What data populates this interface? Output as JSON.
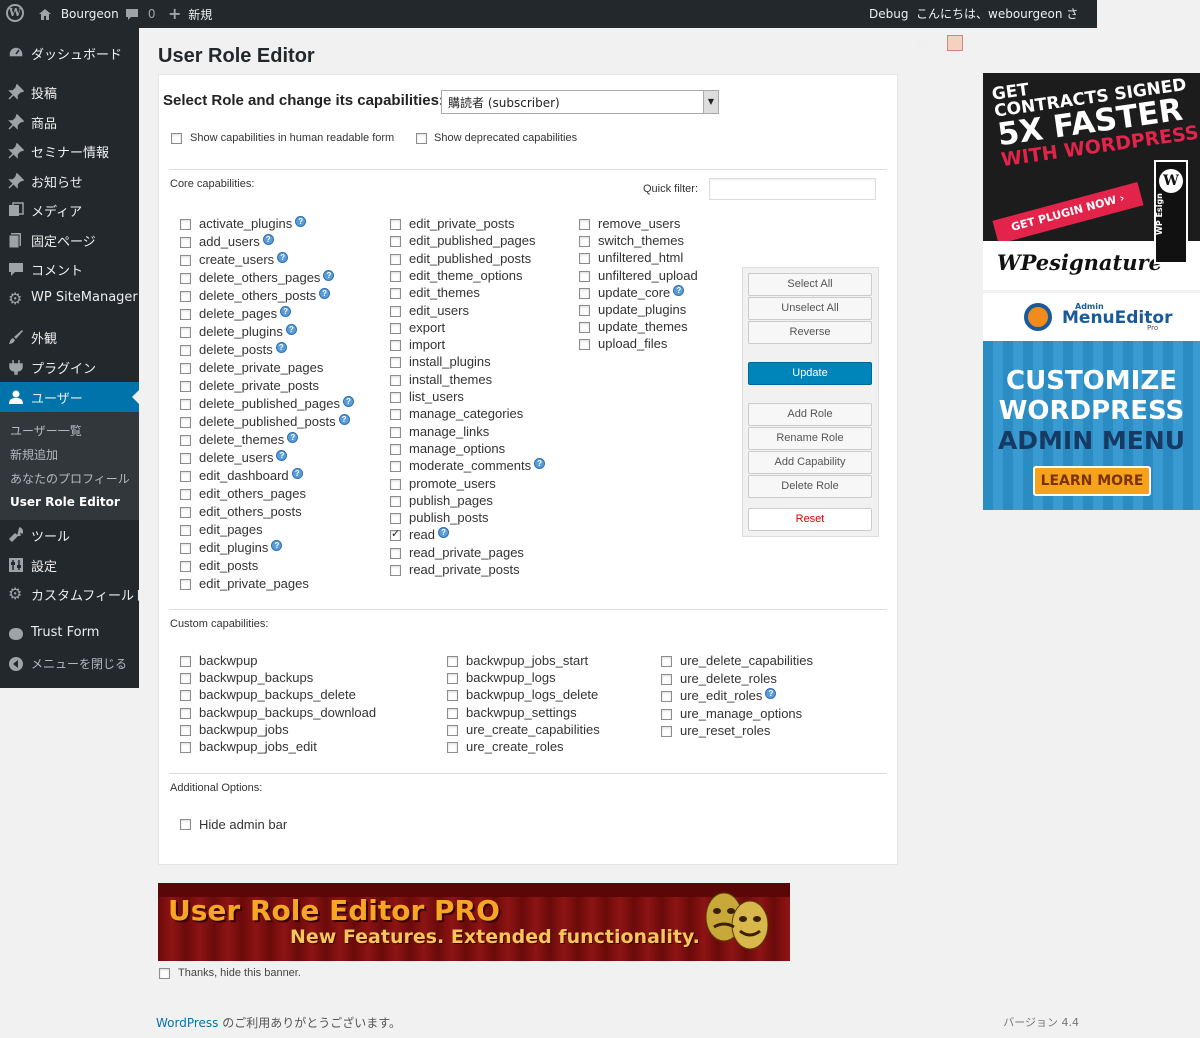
{
  "adminbar": {
    "wp_logo": "W",
    "site_name": "Bourgeon",
    "comments_count": "0",
    "new_label": "新規",
    "debug_label": "Debug",
    "greeting": "こんにちは、webourgeon さん！"
  },
  "sidebar": {
    "items": [
      {
        "label": "ダッシュボード",
        "icon": "dashboard-icon"
      },
      {
        "label": "投稿",
        "icon": "pin-icon"
      },
      {
        "label": "商品",
        "icon": "pin-icon"
      },
      {
        "label": "セミナー情報",
        "icon": "pin-icon"
      },
      {
        "label": "お知らせ",
        "icon": "pin-icon"
      },
      {
        "label": "メディア",
        "icon": "media-icon"
      },
      {
        "label": "固定ページ",
        "icon": "page-icon"
      },
      {
        "label": "コメント",
        "icon": "comment-icon"
      },
      {
        "label": "WP SiteManager",
        "icon": "gear-icon"
      },
      {
        "label": "外観",
        "icon": "brush-icon"
      },
      {
        "label": "プラグイン",
        "icon": "plug-icon"
      },
      {
        "label": "ユーザー",
        "icon": "user-icon"
      },
      {
        "label": "ツール",
        "icon": "wrench-icon"
      },
      {
        "label": "設定",
        "icon": "settings-icon"
      },
      {
        "label": "カスタムフィールド",
        "icon": "gear-icon"
      },
      {
        "label": "Trust Form",
        "icon": "form-icon"
      },
      {
        "label": "メニューを閉じる",
        "icon": "collapse-icon"
      }
    ],
    "submenu": [
      "ユーザー一覧",
      "新規追加",
      "あなたのプロフィール",
      "User Role Editor"
    ]
  },
  "page": {
    "title": "User Role Editor",
    "select_role_label": "Select Role and change its capabilities:",
    "selected_role": "購読者 (subscriber)",
    "show_human_label": "Show capabilities in human readable form",
    "show_deprecated_label": "Show deprecated capabilities",
    "core_label": "Core capabilities:",
    "quick_filter_label": "Quick filter:",
    "custom_label": "Custom capabilities:",
    "additional_label": "Additional Options:",
    "hide_admin_bar_label": "Hide admin bar"
  },
  "core_caps": {
    "col1": [
      "activate_plugins",
      "add_users",
      "create_users",
      "delete_others_pages",
      "delete_others_posts",
      "delete_pages",
      "delete_plugins",
      "delete_posts",
      "delete_private_pages",
      "delete_private_posts",
      "delete_published_pages",
      "delete_published_posts",
      "delete_themes",
      "delete_users",
      "edit_dashboard",
      "edit_others_pages",
      "edit_others_posts",
      "edit_pages",
      "edit_plugins",
      "edit_posts",
      "edit_private_pages"
    ],
    "col2": [
      "edit_private_posts",
      "edit_published_pages",
      "edit_published_posts",
      "edit_theme_options",
      "edit_themes",
      "edit_users",
      "export",
      "import",
      "install_plugins",
      "install_themes",
      "list_users",
      "manage_categories",
      "manage_links",
      "manage_options",
      "moderate_comments",
      "promote_users",
      "publish_pages",
      "publish_posts",
      "read",
      "read_private_pages",
      "read_private_posts"
    ],
    "col3": [
      "remove_users",
      "switch_themes",
      "unfiltered_html",
      "unfiltered_upload",
      "update_core",
      "update_plugins",
      "update_themes",
      "upload_files"
    ]
  },
  "custom_caps": {
    "col1": [
      "backwpup",
      "backwpup_backups",
      "backwpup_backups_delete",
      "backwpup_backups_download",
      "backwpup_jobs",
      "backwpup_jobs_edit"
    ],
    "col2": [
      "backwpup_jobs_start",
      "backwpup_logs",
      "backwpup_logs_delete",
      "backwpup_settings",
      "ure_create_capabilities",
      "ure_create_roles"
    ],
    "col3": [
      "ure_delete_capabilities",
      "ure_delete_roles",
      "ure_edit_roles",
      "ure_manage_options",
      "ure_reset_roles"
    ]
  },
  "buttons": {
    "select_all": "Select All",
    "unselect_all": "Unselect All",
    "reverse": "Reverse",
    "update": "Update",
    "add_role": "Add Role",
    "rename_role": "Rename Role",
    "add_capability": "Add Capability",
    "delete_role": "Delete Role",
    "reset": "Reset"
  },
  "ads": {
    "ad1_line1": "GET",
    "ad1_line2": "CONTRACTS SIGNED",
    "ad1_line3": "5X FASTER",
    "ad1_line4": "WITH WORDPRESS",
    "ad1_cta": "GET PLUGIN NOW ›",
    "ad1_brand": "WPesignature",
    "ad1_side": "WP Esign",
    "ad2_small": "Admin",
    "ad2_brand": "MenuEditor",
    "ad2_pro": "Pro",
    "ad2_line1": "CUSTOMIZE",
    "ad2_line2": "WORDPRESS",
    "ad2_line3": "ADMIN MENU",
    "ad2_cta": "LEARN MORE",
    "banner_title": "User Role Editor PRO",
    "banner_sub": "New Features. Extended functionality.",
    "hide_banner": "Thanks, hide this banner."
  },
  "footer": {
    "link": "WordPress",
    "thanks": " のご利用ありがとうございます。",
    "version": "バージョン 4.4"
  },
  "colors": {
    "adminbar": "#23282d",
    "accent": "#0073aa",
    "primary_button": "#0085ba",
    "reset_text": "#dd0000"
  }
}
